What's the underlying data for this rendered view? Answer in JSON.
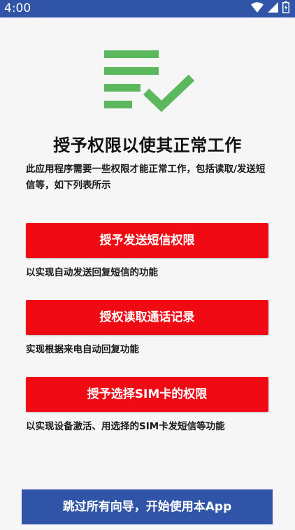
{
  "status_bar": {
    "time": "4:00",
    "icons": [
      "wifi-icon",
      "cellular-signal-icon",
      "battery-charging-icon"
    ]
  },
  "hero": {
    "icon": "checklist-icon",
    "icon_color": "#5cb85c"
  },
  "main": {
    "title": "授予权限以使其正常工作",
    "description": "此应用程序需要一些权限才能正常工作，包括读取/发送短信等，如下列表所示"
  },
  "permissions": [
    {
      "button_label": "授予发送短信权限",
      "caption": "以实现自动发送回复短信的功能"
    },
    {
      "button_label": "授权读取通话记录",
      "caption": "实现根据来电自动回复功能"
    },
    {
      "button_label": "授予选择SIM卡的权限",
      "caption": "以实现设备激活、用选择的SIM卡发短信等功能"
    }
  ],
  "footer": {
    "skip_label": "跳过所有向导，开始使用本App"
  },
  "colors": {
    "accent_red": "#f00a14",
    "brand_blue": "#2f54a8",
    "background": "#f6f6f6"
  }
}
